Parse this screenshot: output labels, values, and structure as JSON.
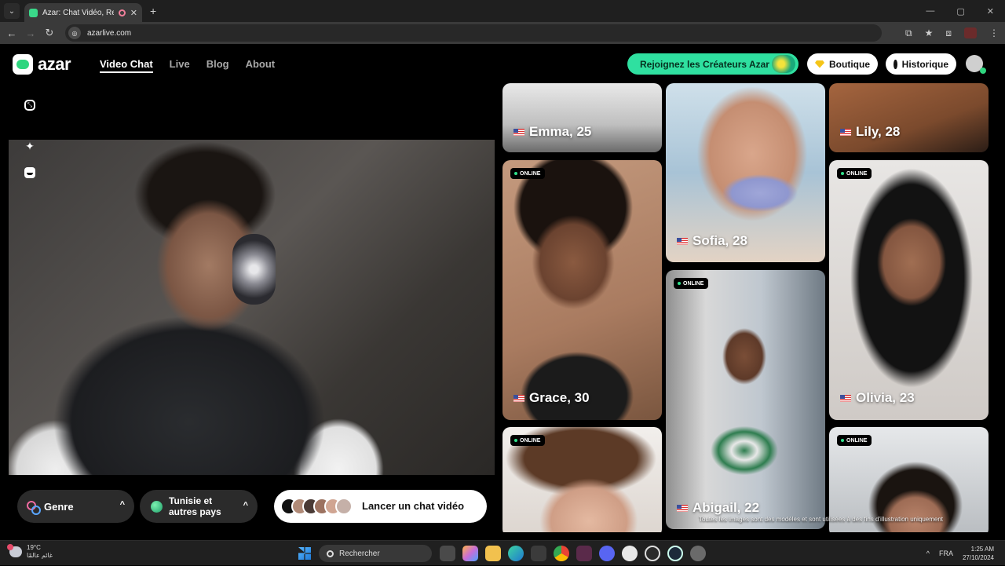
{
  "browser": {
    "tab_title": "Azar: Chat Vidéo, Rencontre",
    "tab_close": "✕",
    "new_tab": "+",
    "tabs_menu": "⌄",
    "url": "azarlive.com",
    "back": "←",
    "forward": "→",
    "reload": "↻",
    "win_min": "—",
    "win_max": "▢",
    "win_close": "✕",
    "star": "★",
    "cast": "⧉",
    "extensions": "⧈",
    "menu": "⋮"
  },
  "header": {
    "logo_text": "azar",
    "nav": [
      {
        "label": "Video Chat",
        "active": true
      },
      {
        "label": "Live"
      },
      {
        "label": "Blog"
      },
      {
        "label": "About"
      }
    ],
    "creators_label": "Rejoignez les Créateurs Azar",
    "boutique_label": "Boutique",
    "historique_label": "Historique"
  },
  "controls": {
    "genre_label": "Genre",
    "pays_line1": "Tunisie et",
    "pays_line2": "autres pays",
    "chevron": "^",
    "start_label": "Lancer un chat vidéo",
    "sparkle": "✦",
    "expand": "⤡"
  },
  "cards": {
    "online_label": "ONLINE",
    "emma": "Emma, 25",
    "lily": "Lily, 28",
    "sofia": "Sofia, 28",
    "grace": "Grace, 30",
    "olivia": "Olivia, 23",
    "abigail": "Abigail, 22"
  },
  "disclaimer": "Toutes les images sont des modèles et sont utilisées à des fins d'illustration uniquement",
  "taskbar": {
    "temperature": "19°C",
    "weather_text": "غائم عالمًا",
    "search_placeholder": "Rechercher",
    "language": "FRA",
    "time": "1:25 AM",
    "date": "27/10/2024",
    "chevron_up": "^"
  },
  "colors": {
    "accent_green": "#2fe0a0",
    "online_dot": "#2fe08a"
  }
}
